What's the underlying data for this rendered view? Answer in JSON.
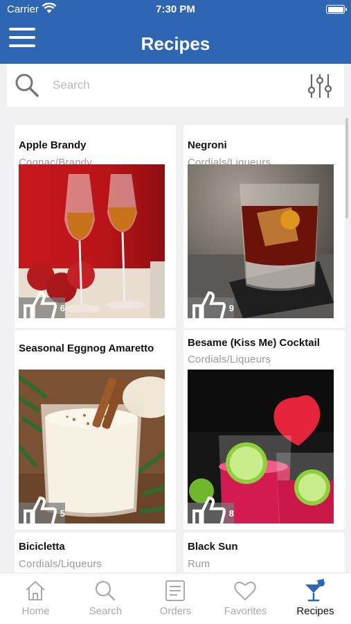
{
  "status": {
    "carrier": "Carrier",
    "time": "7:30 PM"
  },
  "header": {
    "title": "Recipes"
  },
  "search": {
    "placeholder": "Search"
  },
  "recipes": [
    {
      "name": "Apple Brandy",
      "category": "Cognac/Brandy",
      "likes": "6"
    },
    {
      "name": "Negroni",
      "category": "Cordials/Liqueurs",
      "likes": "9"
    },
    {
      "name": "Seasonal Eggnog Amaretto",
      "category": "",
      "likes": "5"
    },
    {
      "name": "Besame (Kiss Me) Cocktail",
      "category": "Cordials/Liqueurs",
      "likes": "8"
    },
    {
      "name": "Bicicletta",
      "category": "Cordials/Liqueurs",
      "likes": ""
    },
    {
      "name": "Black Sun",
      "category": "Rum",
      "likes": ""
    }
  ],
  "tabs": [
    {
      "label": "Home",
      "icon": "home-icon"
    },
    {
      "label": "Search",
      "icon": "search-icon"
    },
    {
      "label": "Orders",
      "icon": "orders-icon"
    },
    {
      "label": "Favorites",
      "icon": "heart-icon"
    },
    {
      "label": "Recipes",
      "icon": "cocktail-icon",
      "active": true
    }
  ],
  "colors": {
    "header": "#2f66b3",
    "active_tab_icon": "#2f66b3",
    "inactive": "#a9a9a9"
  }
}
